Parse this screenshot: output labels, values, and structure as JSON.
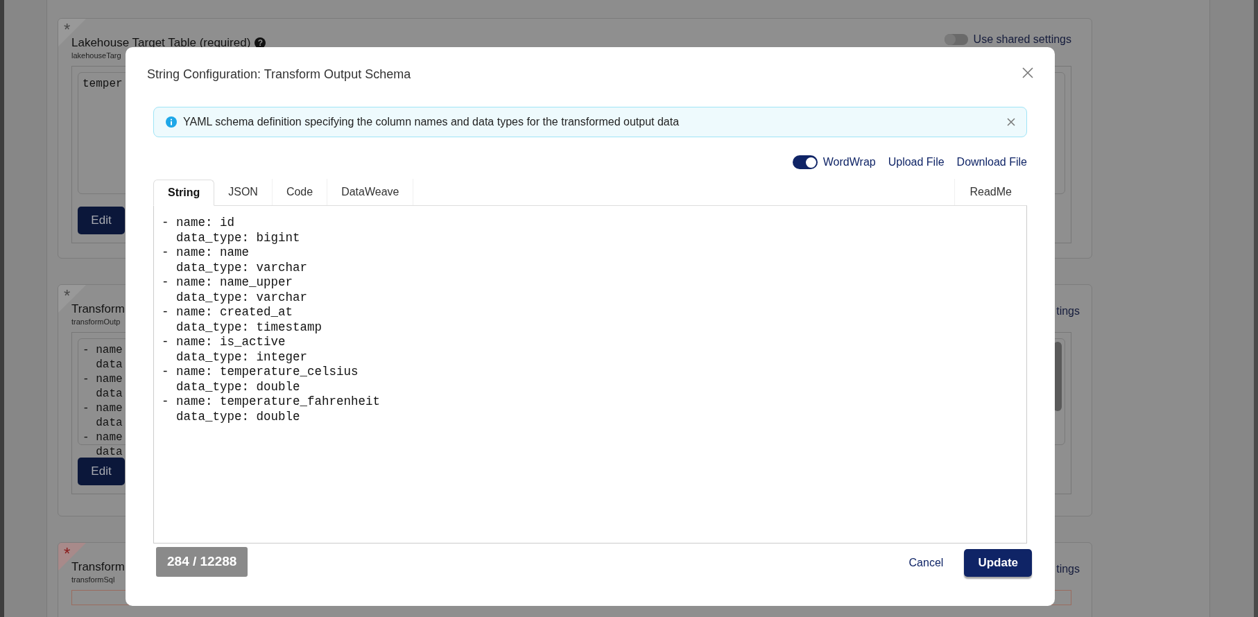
{
  "background": {
    "cards": [
      {
        "asterisk": "*",
        "error": false,
        "title": "Lakehouse Target Table (required)",
        "help": "?",
        "key": "lakehouseTarg",
        "shared": {
          "label": "Use shared settings",
          "on": false
        },
        "value_lines": [
          "temper"
        ],
        "scrollbar": false,
        "edit": "Edit"
      },
      {
        "asterisk": "*",
        "error": false,
        "title": "Transform",
        "key": "transformOutp",
        "shared": {
          "label": "tings"
        },
        "value_lines": [
          "- name",
          "  data",
          "- name",
          "  data",
          "- name",
          "  data",
          "- name",
          "  data"
        ],
        "scrollbar": true,
        "edit": "Edit"
      },
      {
        "asterisk": "*",
        "error": true,
        "title": "Transform",
        "key": "transformSql",
        "shared": {
          "label": "tings"
        }
      }
    ]
  },
  "dialog": {
    "title": "String Configuration: Transform Output Schema",
    "info": "YAML schema definition specifying the column names and data types for the transformed output data",
    "wordwrap": {
      "label": "WordWrap",
      "on": true
    },
    "links": [
      "Upload File",
      "Download File"
    ],
    "tabs": [
      {
        "label": "String",
        "selected": true
      },
      {
        "label": "JSON",
        "selected": false
      },
      {
        "label": "Code",
        "selected": false
      },
      {
        "label": "DataWeave",
        "selected": false
      }
    ],
    "readme": "ReadMe",
    "code_lines": [
      "- name: id",
      "  data_type: bigint",
      "- name: name",
      "  data_type: varchar",
      "- name: name_upper",
      "  data_type: varchar",
      "- name: created_at",
      "  data_type: timestamp",
      "- name: is_active",
      "  data_type: integer",
      "- name: temperature_celsius",
      "  data_type: double",
      "- name: temperature_fahrenheit",
      "  data_type: double"
    ],
    "counter": "284 / 12288",
    "buttons": {
      "cancel": "Cancel",
      "submit": "Update"
    }
  }
}
